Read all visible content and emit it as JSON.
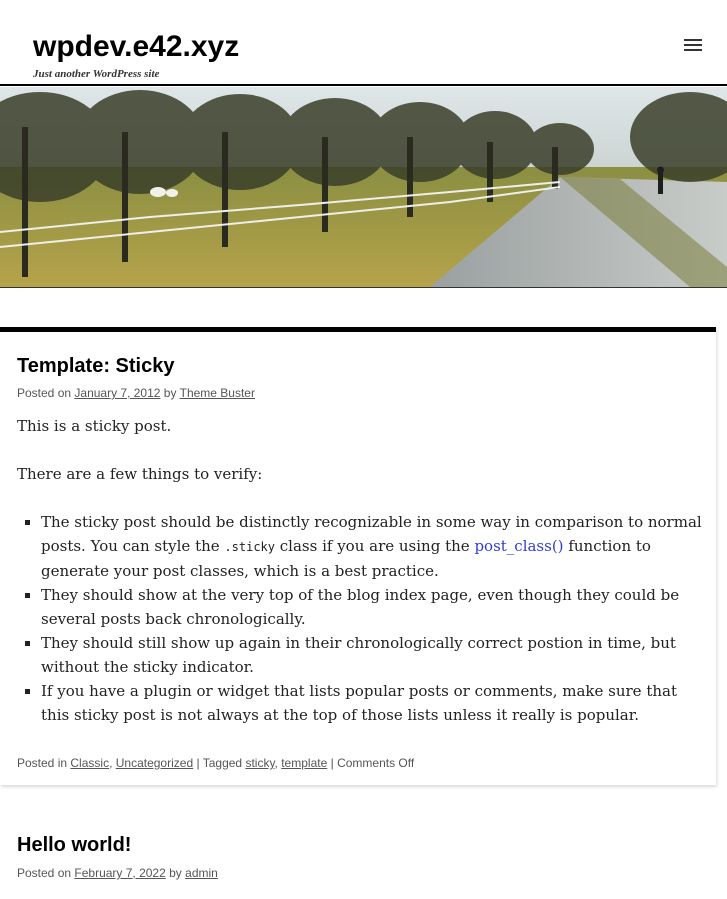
{
  "site": {
    "title": "wpdev.e42.xyz",
    "description": "Just another WordPress site",
    "menu_icon": "hamburger-icon"
  },
  "header_image": {
    "alt": "Tree-lined country lane"
  },
  "posts": [
    {
      "title": "Template: Sticky",
      "posted_on": "Posted on",
      "date": "January 7, 2012",
      "by": "by",
      "author": "Theme Buster",
      "content": {
        "p1": "This is a sticky post.",
        "p2": "There are a few things to verify:",
        "li1_a": "The sticky post should be distinctly recognizable in some way in comparison to normal posts. You can style the",
        "li1_code": ".sticky",
        "li1_b": "class if you are using the",
        "li1_link": "post_class()",
        "li1_c": "function to generate your post classes, which is a best practice.",
        "li2": "They should show at the very top of the blog index page, even though they could be several posts back chronologically.",
        "li3": "They should still show up again in their chronologically correct postion in time, but without the sticky indicator.",
        "li4": "If you have a plugin or widget that lists popular posts or comments, make sure that this sticky post is not always at the top of those lists unless it really is popular."
      },
      "footer": {
        "posted_in": "Posted in",
        "categories": [
          "Classic",
          "Uncategorized"
        ],
        "sep1": "|",
        "tagged": "Tagged",
        "tags": [
          "sticky",
          "template"
        ],
        "sep2": "|",
        "comments": "Comments Off"
      }
    },
    {
      "title": "Hello world!",
      "posted_on": "Posted on",
      "date": "February 7, 2022",
      "by": "by",
      "author": "admin"
    }
  ]
}
